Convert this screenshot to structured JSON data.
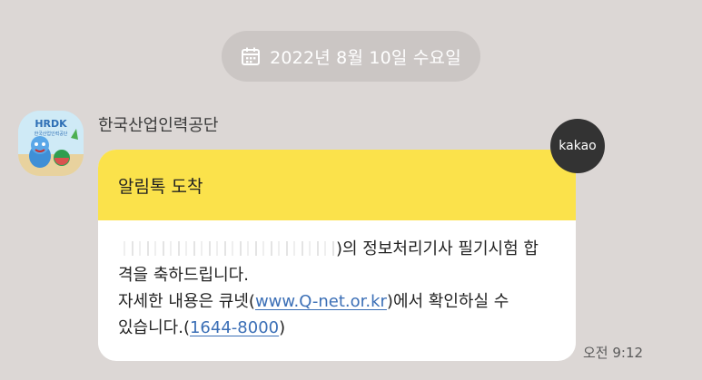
{
  "date_pill": {
    "icon": "calendar-icon",
    "text": "2022년 8월 10일 수요일"
  },
  "message": {
    "sender": "한국산업인력공단",
    "avatar_text": "HRDK",
    "avatar_subtext": "한국산업인력공단",
    "badge": "kakao",
    "header": "알림톡 도착",
    "body": {
      "line1_suffix": ")의 정보처리기사 필기시험 합",
      "line2": "격을 축하드립니다.",
      "line3_prefix": "자세한 내용은 큐넷(",
      "link_url": "www.Q-net.or.kr",
      "line3_suffix": ")에서 확인하실 수",
      "line4_prefix": "있습니다.(",
      "link_phone": "1644-8000",
      "line4_suffix": ")"
    },
    "timestamp": "오전 9:12"
  },
  "colors": {
    "background": "#dcd7d5",
    "pill": "#cbc6c4",
    "header_yellow": "#fbe24b",
    "badge": "#333333",
    "link": "#3b6fb6"
  }
}
